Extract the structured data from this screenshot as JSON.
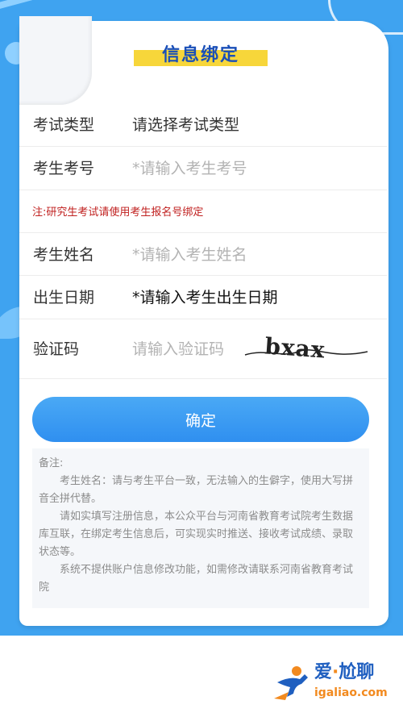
{
  "page": {
    "title": "信息绑定"
  },
  "form": {
    "exam_type": {
      "label": "考试类型",
      "value": "请选择考试类型"
    },
    "exam_no": {
      "label": "考生考号",
      "placeholder": "*请输入考生考号"
    },
    "notice": "注:研究生考试请使用考生报名号绑定",
    "name": {
      "label": "考生姓名",
      "placeholder": "*请输入考生姓名"
    },
    "birth": {
      "label": "出生日期",
      "value": "*请输入考生出生日期"
    },
    "captcha": {
      "label": "验证码",
      "placeholder": "请输入验证码",
      "image_text": "bxax"
    }
  },
  "confirm_label": "确定",
  "remarks": {
    "title": "备注:",
    "paragraphs": [
      "考生姓名：请与考生平台一致，无法输入的生僻字，使用大写拼音全拼代替。",
      "请如实填写注册信息，本公众平台与河南省教育考试院考生数据库互联，在绑定考生信息后，可实现实时推送、接收考试成绩、录取状态等。",
      "系统不提供账户信息修改功能，如需修改请联系河南省教育考试院"
    ]
  },
  "watermark": {
    "top": "爱",
    "dot": "·",
    "top2": "尬聊",
    "bottom": "igaliao.com"
  },
  "colors": {
    "background": "#3fa3f0",
    "accent": "#2f8ff0",
    "notice": "#c0201f",
    "title_highlight": "#f7d63a"
  }
}
